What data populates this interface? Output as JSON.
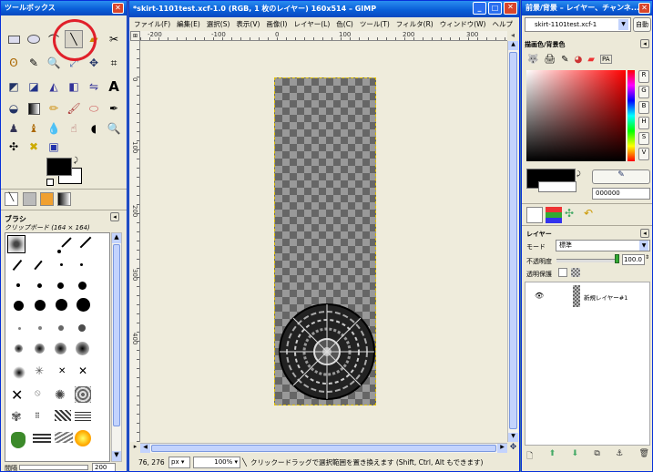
{
  "toolbox": {
    "title": "ツールボックス",
    "brushes_title": "ブラシ",
    "brush_name": "クリップボード (164 × 164)",
    "spacing_label": "間隔",
    "spacing_value": "200"
  },
  "main": {
    "title": "*skirt-1101test.xcf-1.0 (RGB, 1 枚のレイヤー) 160x514 – GIMP",
    "menu": [
      "ファイル(F)",
      "編集(E)",
      "選択(S)",
      "表示(V)",
      "画像(I)",
      "レイヤー(L)",
      "色(C)",
      "ツール(T)",
      "フィルタ(R)",
      "ウィンドウ(W)",
      "ヘルプ"
    ],
    "ruler_h": [
      "-200",
      "-100",
      "0",
      "100",
      "200",
      "300"
    ],
    "ruler_v": [
      "0",
      "100",
      "200",
      "300",
      "400"
    ],
    "coords": "76, 276",
    "unit": "px",
    "zoom": "100%",
    "status": "クリックードラッグで選択範囲を置き換えます (Shift, Ctrl, Alt もできます)"
  },
  "dock": {
    "title": "前景/背景 – レイヤー、チャンネ...",
    "image_select": "skirt-1101test.xcf-1",
    "auto_label": "自動",
    "fgbg_title": "描画色/背景色",
    "hex_value": "000000",
    "channels": [
      "R",
      "G",
      "B",
      "H",
      "S",
      "V"
    ],
    "layers_title": "レイヤー",
    "mode_label": "モード",
    "mode_value": "標準",
    "opacity_label": "不透明度",
    "opacity_value": "100.0",
    "lock_label": "透明保護",
    "layer_name": "新規レイヤー#1"
  },
  "colors": {
    "accent": "#0a5fd8",
    "highlight_circle": "#e0202a"
  }
}
